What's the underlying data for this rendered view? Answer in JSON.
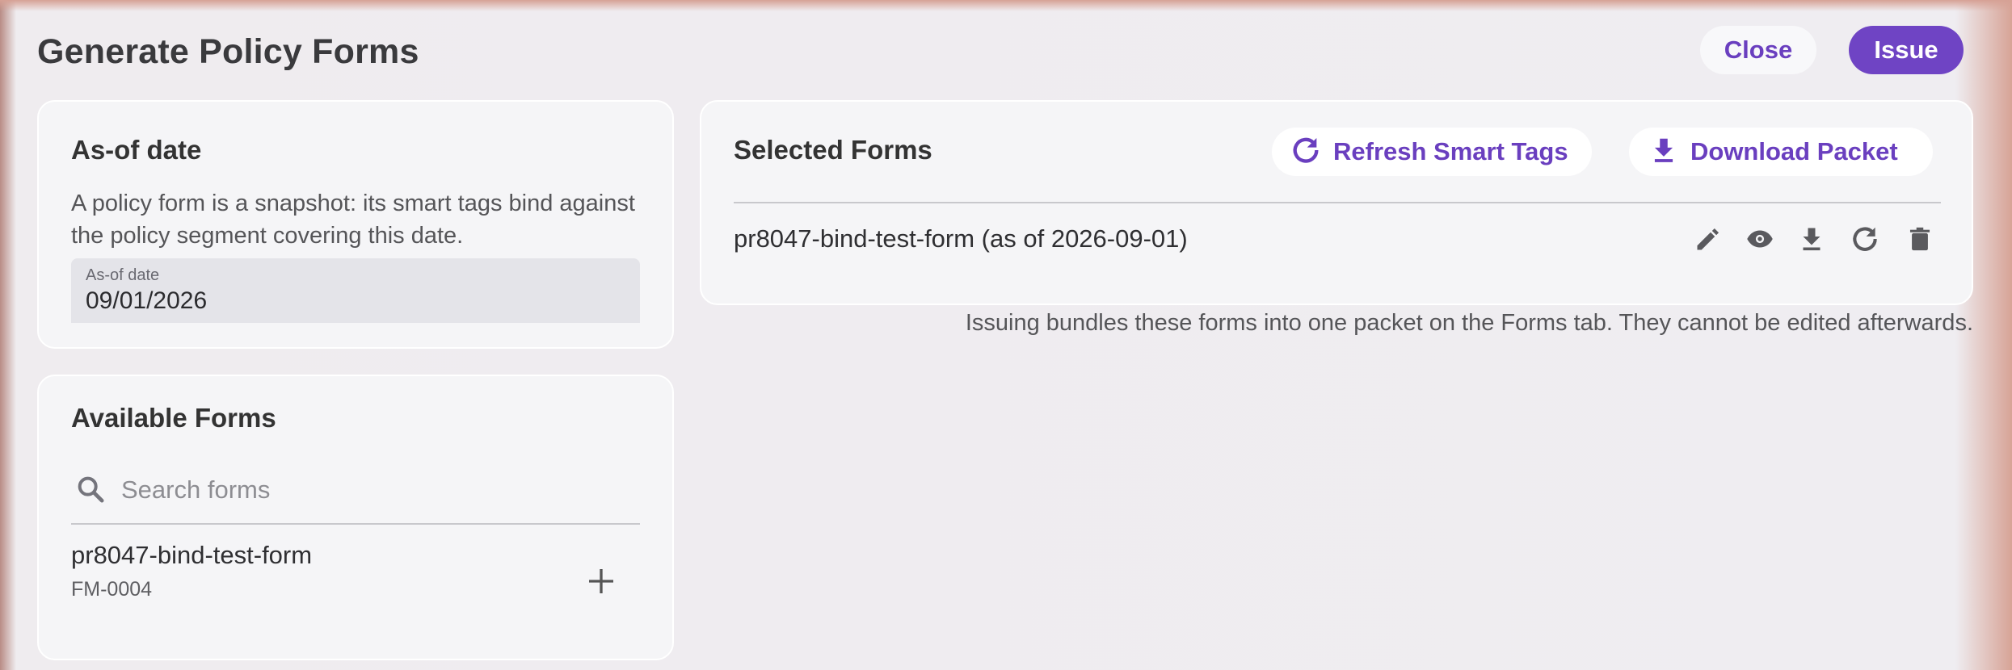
{
  "dialog": {
    "title": "Generate Policy Forms",
    "close_label": "Close",
    "issue_label": "Issue"
  },
  "as_of": {
    "heading": "As-of date",
    "description": "A policy form is a snapshot: its smart tags bind against the policy segment covering this date.",
    "field_label": "As-of date",
    "field_value": "09/01/2026"
  },
  "available": {
    "heading": "Available Forms",
    "search_placeholder": "Search forms",
    "items": [
      {
        "name": "pr8047-bind-test-form",
        "code": "FM-0004"
      }
    ]
  },
  "selected": {
    "heading": "Selected Forms",
    "refresh_label": "Refresh Smart Tags",
    "download_label": "Download Packet",
    "rows": [
      {
        "label": "pr8047-bind-test-form (as of 2026-09-01)"
      }
    ],
    "row_actions": [
      "edit-icon",
      "view-icon",
      "download-icon",
      "refresh-icon",
      "delete-icon"
    ],
    "footnote": "Issuing bundles these forms into one packet on the Forms tab. They cannot be edited afterwards."
  },
  "colors": {
    "accent": "#6f44c4",
    "accent_text": "#6a3fbf",
    "card_bg": "#f5f5f7",
    "page_bg": "#efedf1"
  }
}
